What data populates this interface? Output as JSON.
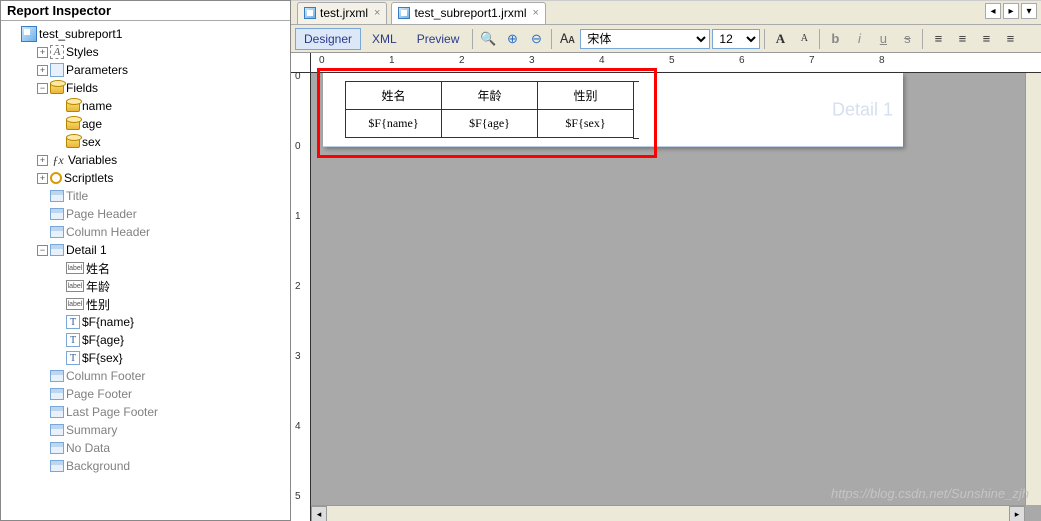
{
  "inspector": {
    "title": "Report Inspector",
    "root": "test_subreport1",
    "nodes": {
      "styles": "Styles",
      "parameters": "Parameters",
      "fields": "Fields",
      "f_name": "name",
      "f_age": "age",
      "f_sex": "sex",
      "variables": "Variables",
      "scriptlets": "Scriptlets",
      "title_s": "Title",
      "page_header": "Page Header",
      "column_header": "Column Header",
      "detail1": "Detail 1",
      "d_l1": "姓名",
      "d_l2": "年龄",
      "d_l3": "性别",
      "d_f1": "$F{name}",
      "d_f2": "$F{age}",
      "d_f3": "$F{sex}",
      "column_footer": "Column Footer",
      "page_footer": "Page Footer",
      "last_page_footer": "Last Page Footer",
      "summary": "Summary",
      "no_data": "No Data",
      "background": "Background"
    }
  },
  "tabs": {
    "t1": "test.jrxml",
    "t2": "test_subreport1.jrxml"
  },
  "toolbar": {
    "designer": "Designer",
    "xml": "XML",
    "preview": "Preview",
    "font": "宋体",
    "size": "12"
  },
  "canvas": {
    "band_label": "Detail 1",
    "h1": "姓名",
    "h2": "年龄",
    "h3": "性别",
    "r1": "$F{name}",
    "r2": "$F{age}",
    "r3": "$F{sex}"
  },
  "watermark": "https://blog.csdn.net/Sunshine_zjh"
}
